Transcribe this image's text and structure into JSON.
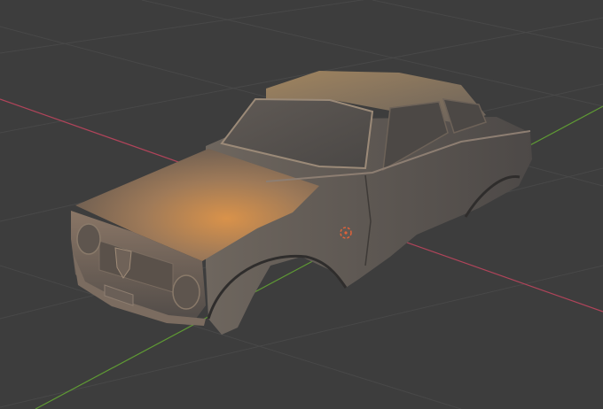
{
  "viewport": {
    "background": "#3d3d3d",
    "grid_color": "#4a4a4a",
    "x_axis_color": "#b0445a",
    "y_axis_color": "#5f9a34",
    "model_color": "#8a7a6c",
    "key_light_color": "#d9924a",
    "origin_marker_color": "#e0623a"
  },
  "scene": {
    "object": "car-body-shell",
    "has_3d_cursor": true
  }
}
